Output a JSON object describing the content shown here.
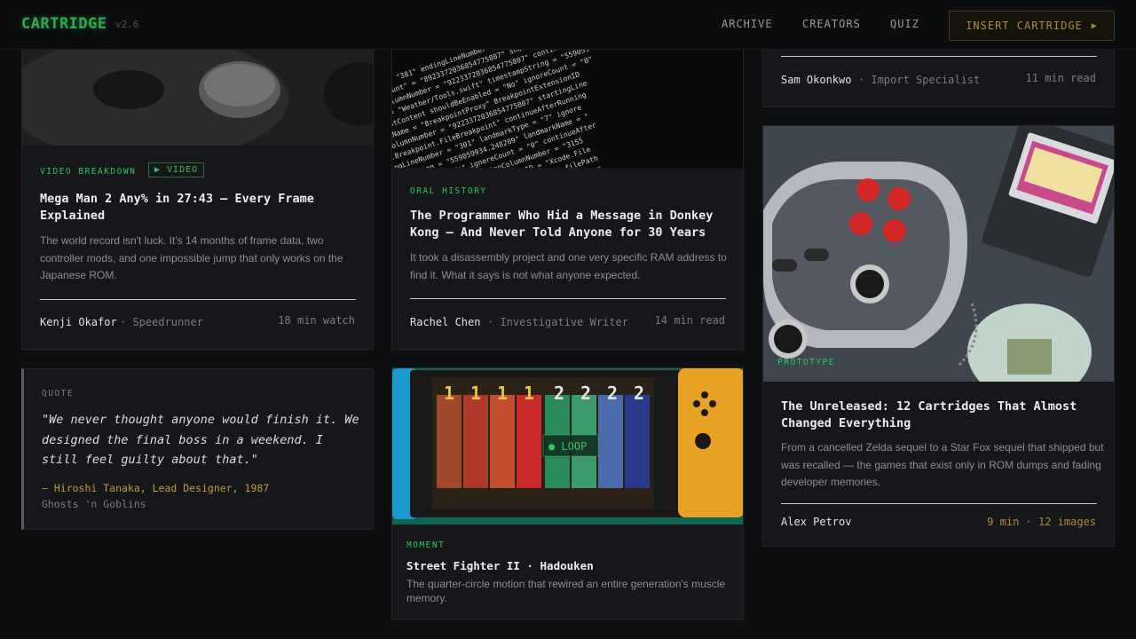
{
  "header": {
    "logo": "CARTRIDGE",
    "version": "v2.6",
    "nav": [
      "ARCHIVE",
      "CREATORS",
      "QUIZ"
    ],
    "cta": "INSERT CARTRIDGE",
    "cta_icon": "play-triangle-icon"
  },
  "cards": {
    "megaman": {
      "tag": "VIDEO BREAKDOWN",
      "badge": "VIDEO",
      "title": "Mega Man 2 Any% in 27:43 — Every Frame Explained",
      "desc": "The world record isn't luck. It's 14 months of frame data, two controller mods, and one impossible jump that only works on the Japanese ROM.",
      "author": "Kenji Okafor",
      "role": "Speedrunner",
      "meta": "18 min watch"
    },
    "quote": {
      "tag": "QUOTE",
      "text": "\"We never thought anyone would finish it. We designed the final boss in a weekend. I still feel guilty about that.\"",
      "attribution": "— Hiroshi Tanaka, Lead Designer, 1987",
      "game": "Ghosts 'n Goblins"
    },
    "donkeykong": {
      "tag": "ORAL HISTORY",
      "title": "The Programmer Who Hid a Message in Donkey Kong — And Never Told Anyone for 30 Years",
      "desc": "It took a disassembly project and one very specific RAM address to find it. What it says is not what anyone expected.",
      "author": "Rachel Chen",
      "role": "Investigative Writer",
      "meta": "14 min read"
    },
    "streetfighter": {
      "tag": "MOMENT",
      "title": "Street Fighter II · Hadouken",
      "desc": "The quarter-circle motion that rewired an entire generation's muscle memory.",
      "loop": "● LOOP"
    },
    "top_right": {
      "author": "Sam Okonkwo",
      "role": "Import Specialist",
      "meta": "11 min read"
    },
    "unreleased": {
      "tag": "PROTOTYPE",
      "title": "The Unreleased: 12 Cartridges That Almost Changed Everything",
      "desc": "From a cancelled Zelda sequel to a Star Fox sequel that shipped but was recalled — the games that exist only in ROM dumps and fading developer memories.",
      "author": "Alex Petrov",
      "meta": "9 min · 12 images"
    }
  },
  "colors": {
    "accent_green": "#2ec75a",
    "accent_amber": "#b38a3c",
    "background": "#0e0f11"
  }
}
